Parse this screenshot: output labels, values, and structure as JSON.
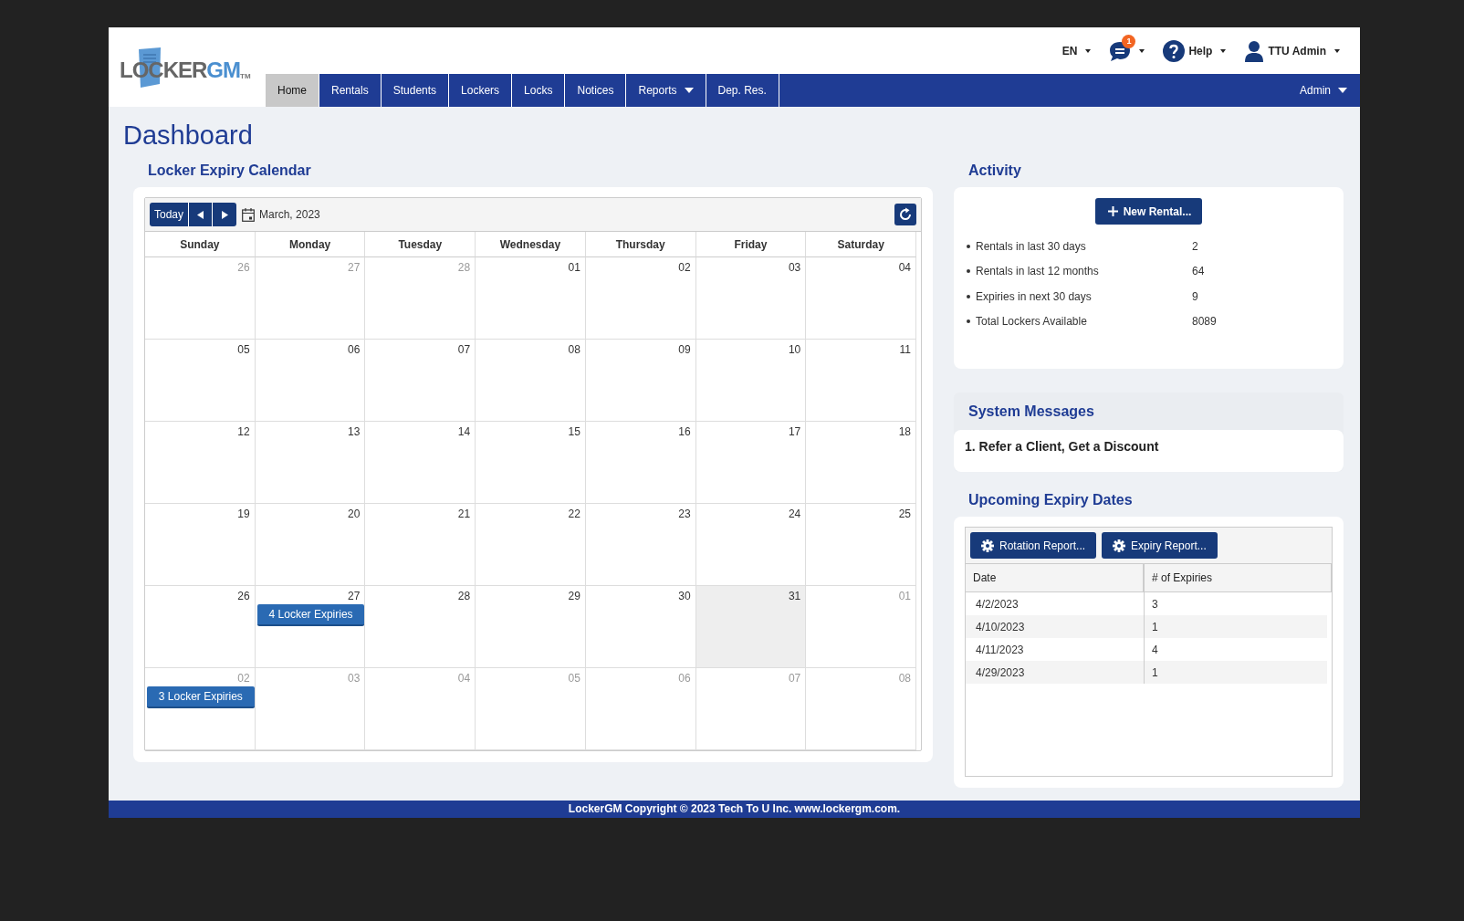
{
  "logo": {
    "part_1": "LOCKER",
    "part_2": "GM",
    "mark": "TM"
  },
  "top_bar": {
    "language": "EN",
    "messages_badge": "1",
    "help": "Help",
    "user": "TTU Admin"
  },
  "nav": {
    "items": [
      {
        "label": "Home",
        "selected": true,
        "dropdown": false
      },
      {
        "label": "Rentals",
        "selected": false,
        "dropdown": false
      },
      {
        "label": "Students",
        "selected": false,
        "dropdown": false
      },
      {
        "label": "Lockers",
        "selected": false,
        "dropdown": false
      },
      {
        "label": "Locks",
        "selected": false,
        "dropdown": false
      },
      {
        "label": "Notices",
        "selected": false,
        "dropdown": false
      },
      {
        "label": "Reports",
        "selected": false,
        "dropdown": true
      },
      {
        "label": "Dep. Res.",
        "selected": false,
        "dropdown": false
      }
    ],
    "right": "Admin"
  },
  "page_title": "Dashboard",
  "calendar": {
    "title": "Locker Expiry Calendar",
    "today_button": "Today",
    "month": "March, 2023",
    "weekdays": [
      "Sunday",
      "Monday",
      "Tuesday",
      "Wednesday",
      "Thursday",
      "Friday",
      "Saturday"
    ],
    "weeks": [
      [
        {
          "day": "26",
          "outside": true,
          "today": false
        },
        {
          "day": "27",
          "outside": true,
          "today": false
        },
        {
          "day": "28",
          "outside": true,
          "today": false
        },
        {
          "day": "01",
          "outside": false,
          "today": false
        },
        {
          "day": "02",
          "outside": false,
          "today": false
        },
        {
          "day": "03",
          "outside": false,
          "today": false
        },
        {
          "day": "04",
          "outside": false,
          "today": false
        }
      ],
      [
        {
          "day": "05",
          "outside": false,
          "today": false
        },
        {
          "day": "06",
          "outside": false,
          "today": false
        },
        {
          "day": "07",
          "outside": false,
          "today": false
        },
        {
          "day": "08",
          "outside": false,
          "today": false
        },
        {
          "day": "09",
          "outside": false,
          "today": false
        },
        {
          "day": "10",
          "outside": false,
          "today": false
        },
        {
          "day": "11",
          "outside": false,
          "today": false
        }
      ],
      [
        {
          "day": "12",
          "outside": false,
          "today": false
        },
        {
          "day": "13",
          "outside": false,
          "today": false
        },
        {
          "day": "14",
          "outside": false,
          "today": false
        },
        {
          "day": "15",
          "outside": false,
          "today": false
        },
        {
          "day": "16",
          "outside": false,
          "today": false
        },
        {
          "day": "17",
          "outside": false,
          "today": false
        },
        {
          "day": "18",
          "outside": false,
          "today": false
        }
      ],
      [
        {
          "day": "19",
          "outside": false,
          "today": false
        },
        {
          "day": "20",
          "outside": false,
          "today": false
        },
        {
          "day": "21",
          "outside": false,
          "today": false
        },
        {
          "day": "22",
          "outside": false,
          "today": false
        },
        {
          "day": "23",
          "outside": false,
          "today": false
        },
        {
          "day": "24",
          "outside": false,
          "today": false
        },
        {
          "day": "25",
          "outside": false,
          "today": false
        }
      ],
      [
        {
          "day": "26",
          "outside": false,
          "today": false
        },
        {
          "day": "27",
          "outside": false,
          "today": false,
          "event": "4 Locker Expiries"
        },
        {
          "day": "28",
          "outside": false,
          "today": false
        },
        {
          "day": "29",
          "outside": false,
          "today": false
        },
        {
          "day": "30",
          "outside": false,
          "today": false
        },
        {
          "day": "31",
          "outside": false,
          "today": true
        },
        {
          "day": "01",
          "outside": true,
          "today": false
        }
      ],
      [
        {
          "day": "02",
          "outside": true,
          "today": false,
          "event": "3 Locker Expiries"
        },
        {
          "day": "03",
          "outside": true,
          "today": false
        },
        {
          "day": "04",
          "outside": true,
          "today": false
        },
        {
          "day": "05",
          "outside": true,
          "today": false
        },
        {
          "day": "06",
          "outside": true,
          "today": false
        },
        {
          "day": "07",
          "outside": true,
          "today": false
        },
        {
          "day": "08",
          "outside": true,
          "today": false
        }
      ]
    ]
  },
  "activity": {
    "title": "Activity",
    "button": "New Rental...",
    "stats": [
      {
        "label": "Rentals in last 30 days",
        "value": "2"
      },
      {
        "label": "Rentals in last 12 months",
        "value": "64"
      },
      {
        "label": "Expiries in next 30 days",
        "value": "9"
      },
      {
        "label": "Total Lockers Available",
        "value": "8089"
      }
    ]
  },
  "system_messages": {
    "title": "System Messages",
    "items": [
      "1. Refer a Client, Get a Discount"
    ]
  },
  "upcoming": {
    "title": "Upcoming Expiry Dates",
    "buttons": [
      "Rotation Report...",
      "Expiry Report..."
    ],
    "columns": [
      "Date",
      "# of Expiries"
    ],
    "rows": [
      [
        "4/2/2023",
        "3"
      ],
      [
        "4/10/2023",
        "1"
      ],
      [
        "4/11/2023",
        "4"
      ],
      [
        "4/29/2023",
        "1"
      ]
    ]
  },
  "footer": "LockerGM Copyright © 2023 Tech To U Inc. www.lockergm.com."
}
